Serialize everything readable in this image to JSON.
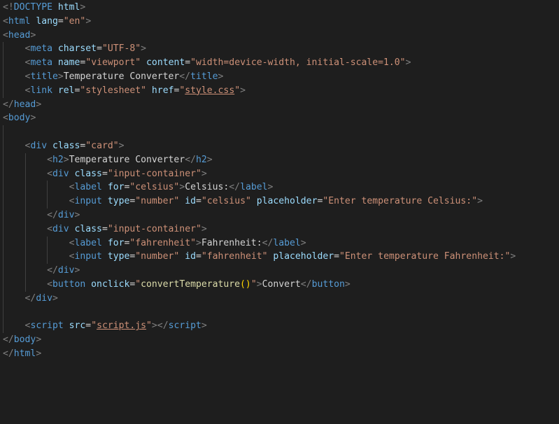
{
  "editor": {
    "language": "html",
    "colors": {
      "background": "#1e1e1e",
      "bracket": "#808080",
      "tag": "#569cd6",
      "attribute": "#9cdcfe",
      "string": "#ce9178",
      "text": "#d4d4d4",
      "function": "#dcdcaa",
      "paren": "#ffd700"
    },
    "lines": [
      {
        "indent": 0,
        "tokens": [
          {
            "t": "bracket",
            "v": "<!"
          },
          {
            "t": "doctype",
            "v": "DOCTYPE"
          },
          {
            "t": "text",
            "v": " "
          },
          {
            "t": "doctype-kw",
            "v": "html"
          },
          {
            "t": "bracket",
            "v": ">"
          }
        ]
      },
      {
        "indent": 0,
        "tokens": [
          {
            "t": "bracket",
            "v": "<"
          },
          {
            "t": "tag",
            "v": "html"
          },
          {
            "t": "text",
            "v": " "
          },
          {
            "t": "attr",
            "v": "lang"
          },
          {
            "t": "eq",
            "v": "="
          },
          {
            "t": "str",
            "v": "\"en\""
          },
          {
            "t": "bracket",
            "v": ">"
          }
        ]
      },
      {
        "indent": 0,
        "tokens": [
          {
            "t": "bracket",
            "v": "<"
          },
          {
            "t": "tag",
            "v": "head"
          },
          {
            "t": "bracket",
            "v": ">"
          }
        ]
      },
      {
        "indent": 1,
        "tokens": [
          {
            "t": "bracket",
            "v": "<"
          },
          {
            "t": "tag",
            "v": "meta"
          },
          {
            "t": "text",
            "v": " "
          },
          {
            "t": "attr",
            "v": "charset"
          },
          {
            "t": "eq",
            "v": "="
          },
          {
            "t": "str",
            "v": "\"UTF-8\""
          },
          {
            "t": "bracket",
            "v": ">"
          }
        ]
      },
      {
        "indent": 1,
        "tokens": [
          {
            "t": "bracket",
            "v": "<"
          },
          {
            "t": "tag",
            "v": "meta"
          },
          {
            "t": "text",
            "v": " "
          },
          {
            "t": "attr",
            "v": "name"
          },
          {
            "t": "eq",
            "v": "="
          },
          {
            "t": "str",
            "v": "\"viewport\""
          },
          {
            "t": "text",
            "v": " "
          },
          {
            "t": "attr",
            "v": "content"
          },
          {
            "t": "eq",
            "v": "="
          },
          {
            "t": "str",
            "v": "\"width=device-width, initial-scale=1.0\""
          },
          {
            "t": "bracket",
            "v": ">"
          }
        ]
      },
      {
        "indent": 1,
        "tokens": [
          {
            "t": "bracket",
            "v": "<"
          },
          {
            "t": "tag",
            "v": "title"
          },
          {
            "t": "bracket",
            "v": ">"
          },
          {
            "t": "text",
            "v": "Temperature Converter"
          },
          {
            "t": "bracket",
            "v": "</"
          },
          {
            "t": "tag",
            "v": "title"
          },
          {
            "t": "bracket",
            "v": ">"
          }
        ]
      },
      {
        "indent": 1,
        "tokens": [
          {
            "t": "bracket",
            "v": "<"
          },
          {
            "t": "tag",
            "v": "link"
          },
          {
            "t": "text",
            "v": " "
          },
          {
            "t": "attr",
            "v": "rel"
          },
          {
            "t": "eq",
            "v": "="
          },
          {
            "t": "str",
            "v": "\"stylesheet\""
          },
          {
            "t": "text",
            "v": " "
          },
          {
            "t": "attr",
            "v": "href"
          },
          {
            "t": "eq",
            "v": "="
          },
          {
            "t": "str",
            "v": "\""
          },
          {
            "t": "str-link",
            "v": "style.css"
          },
          {
            "t": "str",
            "v": "\""
          },
          {
            "t": "bracket",
            "v": ">"
          }
        ]
      },
      {
        "indent": 0,
        "tokens": [
          {
            "t": "bracket",
            "v": "</"
          },
          {
            "t": "tag",
            "v": "head"
          },
          {
            "t": "bracket",
            "v": ">"
          }
        ]
      },
      {
        "indent": 0,
        "tokens": [
          {
            "t": "bracket",
            "v": "<"
          },
          {
            "t": "tag",
            "v": "body"
          },
          {
            "t": "bracket",
            "v": ">"
          }
        ]
      },
      {
        "indent": 0,
        "guides": 1,
        "tokens": []
      },
      {
        "indent": 1,
        "tokens": [
          {
            "t": "bracket",
            "v": "<"
          },
          {
            "t": "tag",
            "v": "div"
          },
          {
            "t": "text",
            "v": " "
          },
          {
            "t": "attr",
            "v": "class"
          },
          {
            "t": "eq",
            "v": "="
          },
          {
            "t": "str",
            "v": "\"card\""
          },
          {
            "t": "bracket",
            "v": ">"
          }
        ]
      },
      {
        "indent": 2,
        "tokens": [
          {
            "t": "bracket",
            "v": "<"
          },
          {
            "t": "tag",
            "v": "h2"
          },
          {
            "t": "bracket",
            "v": ">"
          },
          {
            "t": "text",
            "v": "Temperature Converter"
          },
          {
            "t": "bracket",
            "v": "</"
          },
          {
            "t": "tag",
            "v": "h2"
          },
          {
            "t": "bracket",
            "v": ">"
          }
        ]
      },
      {
        "indent": 2,
        "tokens": [
          {
            "t": "bracket",
            "v": "<"
          },
          {
            "t": "tag",
            "v": "div"
          },
          {
            "t": "text",
            "v": " "
          },
          {
            "t": "attr",
            "v": "class"
          },
          {
            "t": "eq",
            "v": "="
          },
          {
            "t": "str",
            "v": "\"input-container\""
          },
          {
            "t": "bracket",
            "v": ">"
          }
        ]
      },
      {
        "indent": 3,
        "tokens": [
          {
            "t": "bracket",
            "v": "<"
          },
          {
            "t": "tag",
            "v": "label"
          },
          {
            "t": "text",
            "v": " "
          },
          {
            "t": "attr",
            "v": "for"
          },
          {
            "t": "eq",
            "v": "="
          },
          {
            "t": "str",
            "v": "\"celsius\""
          },
          {
            "t": "bracket",
            "v": ">"
          },
          {
            "t": "text",
            "v": "Celsius:"
          },
          {
            "t": "bracket",
            "v": "</"
          },
          {
            "t": "tag",
            "v": "label"
          },
          {
            "t": "bracket",
            "v": ">"
          }
        ]
      },
      {
        "indent": 3,
        "tokens": [
          {
            "t": "bracket",
            "v": "<"
          },
          {
            "t": "tag",
            "v": "input"
          },
          {
            "t": "text",
            "v": " "
          },
          {
            "t": "attr",
            "v": "type"
          },
          {
            "t": "eq",
            "v": "="
          },
          {
            "t": "str",
            "v": "\"number\""
          },
          {
            "t": "text",
            "v": " "
          },
          {
            "t": "attr",
            "v": "id"
          },
          {
            "t": "eq",
            "v": "="
          },
          {
            "t": "str",
            "v": "\"celsius\""
          },
          {
            "t": "text",
            "v": " "
          },
          {
            "t": "attr",
            "v": "placeholder"
          },
          {
            "t": "eq",
            "v": "="
          },
          {
            "t": "str",
            "v": "\"Enter temperature Celsius:\""
          },
          {
            "t": "bracket",
            "v": ">"
          }
        ]
      },
      {
        "indent": 2,
        "tokens": [
          {
            "t": "bracket",
            "v": "</"
          },
          {
            "t": "tag",
            "v": "div"
          },
          {
            "t": "bracket",
            "v": ">"
          }
        ]
      },
      {
        "indent": 2,
        "tokens": [
          {
            "t": "bracket",
            "v": "<"
          },
          {
            "t": "tag",
            "v": "div"
          },
          {
            "t": "text",
            "v": " "
          },
          {
            "t": "attr",
            "v": "class"
          },
          {
            "t": "eq",
            "v": "="
          },
          {
            "t": "str",
            "v": "\"input-container\""
          },
          {
            "t": "bracket",
            "v": ">"
          }
        ]
      },
      {
        "indent": 3,
        "tokens": [
          {
            "t": "bracket",
            "v": "<"
          },
          {
            "t": "tag",
            "v": "label"
          },
          {
            "t": "text",
            "v": " "
          },
          {
            "t": "attr",
            "v": "for"
          },
          {
            "t": "eq",
            "v": "="
          },
          {
            "t": "str",
            "v": "\"fahrenheit\""
          },
          {
            "t": "bracket",
            "v": ">"
          },
          {
            "t": "text",
            "v": "Fahrenheit:"
          },
          {
            "t": "bracket",
            "v": "</"
          },
          {
            "t": "tag",
            "v": "label"
          },
          {
            "t": "bracket",
            "v": ">"
          }
        ]
      },
      {
        "indent": 3,
        "tokens": [
          {
            "t": "bracket",
            "v": "<"
          },
          {
            "t": "tag",
            "v": "input"
          },
          {
            "t": "text",
            "v": " "
          },
          {
            "t": "attr",
            "v": "type"
          },
          {
            "t": "eq",
            "v": "="
          },
          {
            "t": "str",
            "v": "\"number\""
          },
          {
            "t": "text",
            "v": " "
          },
          {
            "t": "attr",
            "v": "id"
          },
          {
            "t": "eq",
            "v": "="
          },
          {
            "t": "str",
            "v": "\"fahrenheit\""
          },
          {
            "t": "text",
            "v": " "
          },
          {
            "t": "attr",
            "v": "placeholder"
          },
          {
            "t": "eq",
            "v": "="
          },
          {
            "t": "str",
            "v": "\"Enter temperature Fahrenheit:\""
          },
          {
            "t": "bracket",
            "v": ">"
          }
        ]
      },
      {
        "indent": 2,
        "tokens": [
          {
            "t": "bracket",
            "v": "</"
          },
          {
            "t": "tag",
            "v": "div"
          },
          {
            "t": "bracket",
            "v": ">"
          }
        ]
      },
      {
        "indent": 2,
        "tokens": [
          {
            "t": "bracket",
            "v": "<"
          },
          {
            "t": "tag",
            "v": "button"
          },
          {
            "t": "text",
            "v": " "
          },
          {
            "t": "attr",
            "v": "onclick"
          },
          {
            "t": "eq",
            "v": "="
          },
          {
            "t": "str",
            "v": "\""
          },
          {
            "t": "fn",
            "v": "convertTemperature"
          },
          {
            "t": "paren",
            "v": "()"
          },
          {
            "t": "str",
            "v": "\""
          },
          {
            "t": "bracket",
            "v": ">"
          },
          {
            "t": "text",
            "v": "Convert"
          },
          {
            "t": "bracket",
            "v": "</"
          },
          {
            "t": "tag",
            "v": "button"
          },
          {
            "t": "bracket",
            "v": ">"
          }
        ]
      },
      {
        "indent": 1,
        "tokens": [
          {
            "t": "bracket",
            "v": "</"
          },
          {
            "t": "tag",
            "v": "div"
          },
          {
            "t": "bracket",
            "v": ">"
          }
        ]
      },
      {
        "indent": 0,
        "guides": 1,
        "tokens": []
      },
      {
        "indent": 1,
        "tokens": [
          {
            "t": "bracket",
            "v": "<"
          },
          {
            "t": "tag",
            "v": "script"
          },
          {
            "t": "text",
            "v": " "
          },
          {
            "t": "attr",
            "v": "src"
          },
          {
            "t": "eq",
            "v": "="
          },
          {
            "t": "str",
            "v": "\""
          },
          {
            "t": "str-link",
            "v": "script.js"
          },
          {
            "t": "str",
            "v": "\""
          },
          {
            "t": "bracket",
            "v": "></"
          },
          {
            "t": "tag",
            "v": "script"
          },
          {
            "t": "bracket",
            "v": ">"
          }
        ]
      },
      {
        "indent": 0,
        "tokens": [
          {
            "t": "bracket",
            "v": "</"
          },
          {
            "t": "tag",
            "v": "body"
          },
          {
            "t": "bracket",
            "v": ">"
          }
        ]
      },
      {
        "indent": 0,
        "tokens": [
          {
            "t": "bracket",
            "v": "</"
          },
          {
            "t": "tag",
            "v": "html"
          },
          {
            "t": "bracket",
            "v": ">"
          }
        ]
      }
    ]
  }
}
